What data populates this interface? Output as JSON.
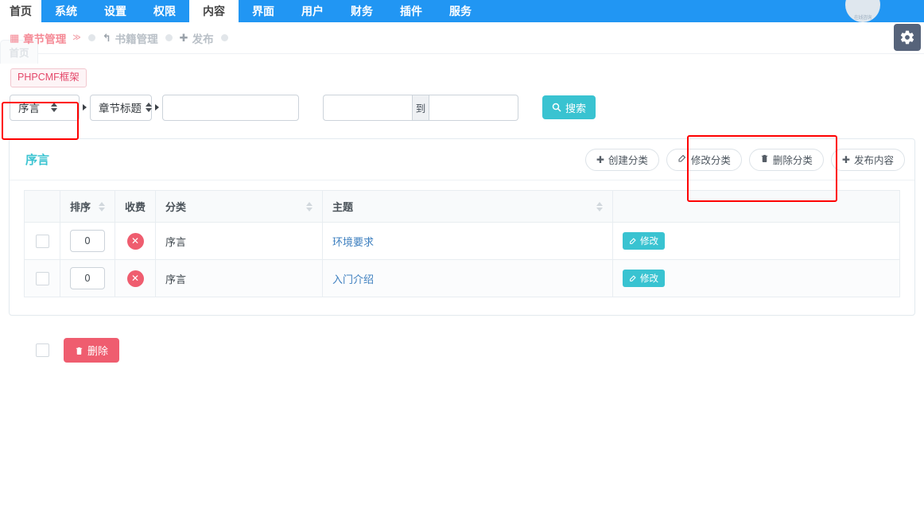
{
  "topnav": {
    "items": [
      {
        "label": "首页",
        "state": "home"
      },
      {
        "label": "系统",
        "state": "normal"
      },
      {
        "label": "设置",
        "state": "normal"
      },
      {
        "label": "权限",
        "state": "normal"
      },
      {
        "label": "内容",
        "state": "active"
      },
      {
        "label": "界面",
        "state": "normal"
      },
      {
        "label": "用户",
        "state": "normal"
      },
      {
        "label": "财务",
        "state": "normal"
      },
      {
        "label": "插件",
        "state": "normal"
      },
      {
        "label": "服务",
        "state": "normal"
      }
    ],
    "logo_text": "在线咨询",
    "accent_blue": "#2196f3"
  },
  "tabbar": {
    "ghost_tab": "首页",
    "tabs": [
      {
        "label": "章节管理",
        "icon": "grid-icon",
        "icon_glyph": "▦",
        "caret": "≫",
        "style": "active"
      },
      {
        "label": "书籍管理",
        "icon": "undo-arrow-icon",
        "icon_glyph": "↰",
        "style": "dim"
      },
      {
        "label": "发布",
        "icon": "plus-icon",
        "icon_glyph": "✚",
        "style": "dim"
      }
    ],
    "gear_icon": "gear-icon"
  },
  "badge": {
    "label": "PHPCMF框架",
    "color": "#e4486a"
  },
  "filter": {
    "category_select": {
      "value": "序言",
      "icon": "stepper-icon"
    },
    "field_select": {
      "value": "章节标题",
      "icon": "stepper-icon"
    },
    "keyword_input": {
      "value": "",
      "placeholder": ""
    },
    "date_start": {
      "value": "",
      "placeholder": ""
    },
    "date_separator": "到",
    "date_end": {
      "value": "",
      "placeholder": ""
    },
    "search_button": {
      "label": "搜索",
      "icon": "search-icon",
      "color": "#39c3d1"
    }
  },
  "panel": {
    "title": "序言",
    "title_color": "#39c3d1",
    "actions": [
      {
        "label": "创建分类",
        "icon": "plus-icon",
        "glyph": "✚"
      },
      {
        "label": "修改分类",
        "icon": "edit-icon",
        "glyph": "✎"
      },
      {
        "label": "删除分类",
        "icon": "trash-icon",
        "glyph": "🗑"
      },
      {
        "label": "发布内容",
        "icon": "plus-icon",
        "glyph": "✚"
      }
    ]
  },
  "table": {
    "columns": [
      {
        "label": "",
        "sortable": false
      },
      {
        "label": "排序",
        "sortable": true
      },
      {
        "label": "收费",
        "sortable": false
      },
      {
        "label": "分类",
        "sortable": true
      },
      {
        "label": "主题",
        "sortable": true
      },
      {
        "label": "",
        "sortable": false
      }
    ],
    "rows": [
      {
        "checked": false,
        "sort_value": "0",
        "fee_icon": "x-circle-icon",
        "fee_glyph": "✕",
        "category": "序言",
        "topic": "环境要求",
        "action_label": "修改",
        "action_icon": "edit-icon"
      },
      {
        "checked": false,
        "sort_value": "0",
        "fee_icon": "x-circle-icon",
        "fee_glyph": "✕",
        "category": "序言",
        "topic": "入门介绍",
        "action_label": "修改",
        "action_icon": "edit-icon"
      }
    ]
  },
  "footer": {
    "select_all_checked": false,
    "delete_button": {
      "label": "删除",
      "icon": "trash-icon",
      "glyph": "🗑",
      "color": "#ef5d6f"
    }
  },
  "annotations": {
    "box_color": "#fe0000",
    "boxes": [
      "category-select-highlight",
      "category-actions-highlight"
    ]
  }
}
